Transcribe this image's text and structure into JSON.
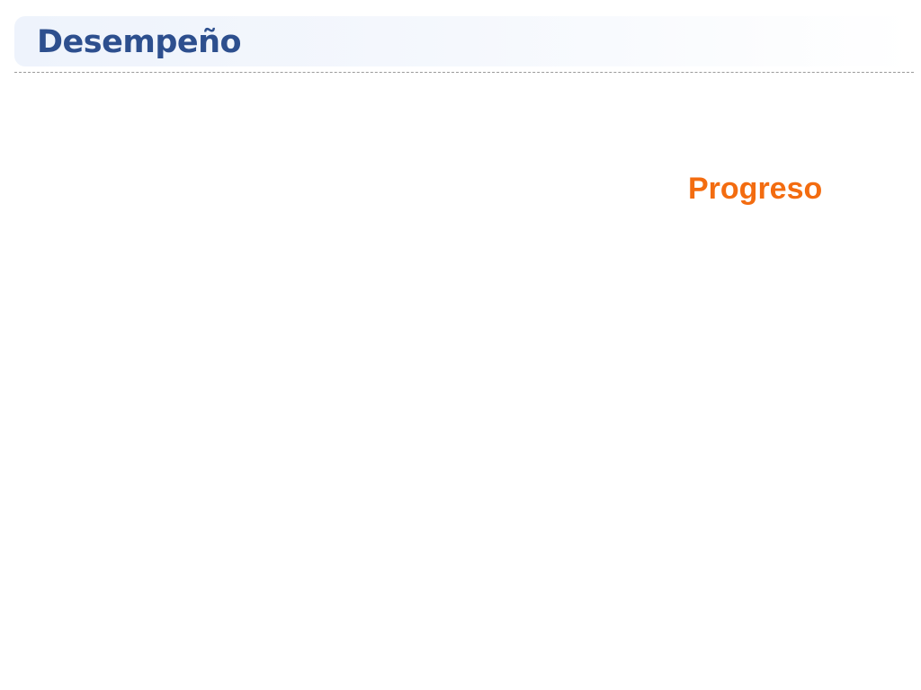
{
  "header": {
    "title": "Desempeño"
  },
  "main": {
    "section_label": "Progreso"
  },
  "colors": {
    "title": "#2d4f8e",
    "accent": "#f36c10",
    "header_background": "#eef3fc"
  }
}
